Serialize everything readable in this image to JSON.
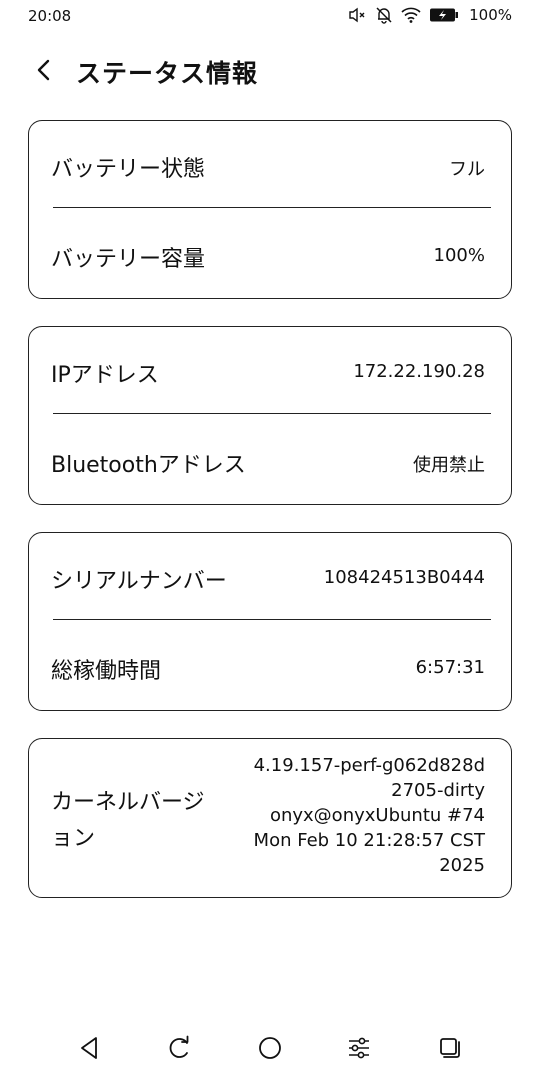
{
  "status_bar": {
    "time": "20:08",
    "battery": "100%",
    "icons": [
      "mute-icon",
      "notifications-off-icon",
      "wifi-icon",
      "battery-charging-icon"
    ]
  },
  "header": {
    "title": "ステータス情報",
    "back_icon": "chevron-left-icon"
  },
  "cards": [
    {
      "rows": [
        {
          "label": "バッテリー状態",
          "value": "フル"
        },
        {
          "label": "バッテリー容量",
          "value": "100%"
        }
      ]
    },
    {
      "rows": [
        {
          "label": "IPアドレス",
          "value": "172.22.190.28"
        },
        {
          "label": "Bluetoothアドレス",
          "value": "使用禁止"
        }
      ]
    },
    {
      "rows": [
        {
          "label": "シリアルナンバー",
          "value": "108424513B0444"
        },
        {
          "label": "総稼働時間",
          "value": "6:57:31"
        }
      ]
    },
    {
      "rows": [
        {
          "label_lines": [
            "カーネルバージ",
            "ョン"
          ],
          "value_lines": [
            "4.19.157-perf-g062d828d",
            "2705-dirty",
            "onyx@onyxUbuntu #74",
            "Mon Feb 10 21:28:57 CST",
            "2025"
          ]
        }
      ]
    }
  ],
  "nav_bar": {
    "icons": [
      "back-triangle-icon",
      "refresh-icon",
      "home-circle-icon",
      "sliders-icon",
      "recent-apps-icon"
    ]
  }
}
